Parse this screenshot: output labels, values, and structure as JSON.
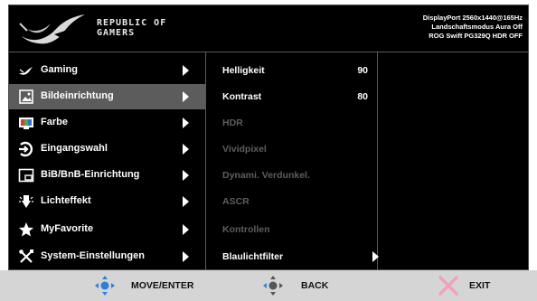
{
  "header": {
    "brand_line1": "REPUBLIC OF",
    "brand_line2": "GAMERS",
    "info_line1": "DisplayPort 2560x1440@165Hz",
    "info_line2": "Landschaftsmodus Aura Off",
    "info_line3": "ROG Swift PG329Q HDR OFF"
  },
  "menu": {
    "items": [
      {
        "label": "Gaming",
        "icon": "rog-eye-icon"
      },
      {
        "label": "Bildeinrichtung",
        "icon": "image-icon",
        "selected": true
      },
      {
        "label": "Farbe",
        "icon": "color-icon"
      },
      {
        "label": "Eingangswahl",
        "icon": "input-icon"
      },
      {
        "label": "BiB/BnB-Einrichtung",
        "icon": "pip-icon"
      },
      {
        "label": "Lichteffekt",
        "icon": "light-effect-icon"
      },
      {
        "label": "MyFavorite",
        "icon": "star-icon"
      },
      {
        "label": "System-Einstellungen",
        "icon": "tools-icon"
      }
    ]
  },
  "submenu": {
    "items": [
      {
        "label": "Helligkeit",
        "value": "90",
        "enabled": true
      },
      {
        "label": "Kontrast",
        "value": "80",
        "enabled": true
      },
      {
        "label": "HDR",
        "enabled": false
      },
      {
        "label": "Vividpixel",
        "enabled": false
      },
      {
        "label": "Dynami. Verdunkel.",
        "enabled": false
      },
      {
        "label": "ASCR",
        "enabled": false
      },
      {
        "label": "Kontrollen",
        "enabled": false
      },
      {
        "label": "Blaulichtfilter",
        "enabled": true,
        "has_submenu": true
      }
    ]
  },
  "footer": {
    "move_enter": "MOVE/ENTER",
    "back": "BACK",
    "exit": "EXIT"
  },
  "colors": {
    "selected_bg": "#5c5c5c",
    "disabled_text": "#5e5e5e",
    "joystick_blue": "#2f7fd6",
    "exit_pink": "#f4a0b8"
  }
}
